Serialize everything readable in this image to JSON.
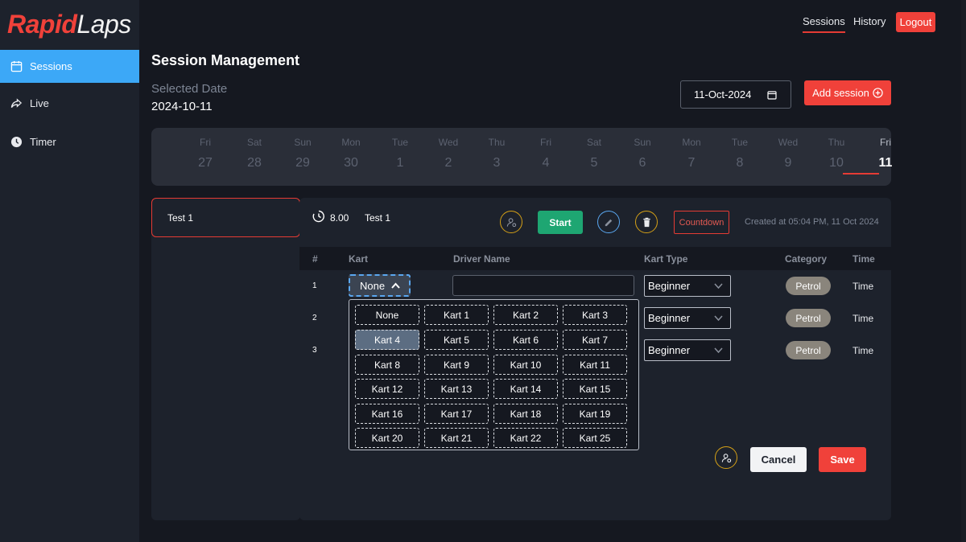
{
  "app": {
    "logo_part1": "Rapid",
    "logo_part2": "Laps"
  },
  "sidebar": {
    "items": [
      {
        "label": "Sessions",
        "icon": "calendar-icon",
        "active": true
      },
      {
        "label": "Live",
        "icon": "share-arrow-icon"
      },
      {
        "label": "Timer",
        "icon": "clock-icon"
      }
    ]
  },
  "topnav": {
    "sessions": "Sessions",
    "history": "History",
    "logout": "Logout"
  },
  "page": {
    "title": "Session Management",
    "selected_date_label": "Selected Date",
    "selected_date_value": "2024-10-11",
    "date_input_value": "11-Oct-2024",
    "add_session_label": "Add session"
  },
  "datestrip": {
    "days": [
      {
        "name": "Fri",
        "num": "27"
      },
      {
        "name": "Sat",
        "num": "28"
      },
      {
        "name": "Sun",
        "num": "29"
      },
      {
        "name": "Mon",
        "num": "30"
      },
      {
        "name": "Tue",
        "num": "1"
      },
      {
        "name": "Wed",
        "num": "2"
      },
      {
        "name": "Thu",
        "num": "3"
      },
      {
        "name": "Fri",
        "num": "4"
      },
      {
        "name": "Sat",
        "num": "5"
      },
      {
        "name": "Sun",
        "num": "6"
      },
      {
        "name": "Mon",
        "num": "7"
      },
      {
        "name": "Tue",
        "num": "8"
      },
      {
        "name": "Wed",
        "num": "9"
      },
      {
        "name": "Thu",
        "num": "10"
      },
      {
        "name": "Fri",
        "num": "11",
        "active": true
      }
    ]
  },
  "sessions": [
    {
      "name": "Test 1"
    }
  ],
  "detail": {
    "duration": "8.00",
    "name": "Test 1",
    "start_label": "Start",
    "countdown_label": "Countdown",
    "created": "Created at 05:04 PM, 11 Oct 2024"
  },
  "table": {
    "headers": {
      "num": "#",
      "kart": "Kart",
      "driver": "Driver Name",
      "kart_type": "Kart Type",
      "category": "Category",
      "time": "Time"
    },
    "rows": [
      {
        "num": "1",
        "kart": "None",
        "kart_type": "Beginner",
        "category": "Petrol",
        "time": "Time"
      },
      {
        "num": "2",
        "kart_type": "Beginner",
        "category": "Petrol",
        "time": "Time"
      },
      {
        "num": "3",
        "kart_type": "Beginner",
        "category": "Petrol",
        "time": "Time"
      }
    ]
  },
  "kart_options": [
    "None",
    "Kart 1",
    "Kart 2",
    "Kart 3",
    "Kart 4",
    "Kart 5",
    "Kart 6",
    "Kart 7",
    "Kart 8",
    "Kart 9",
    "Kart 10",
    "Kart 11",
    "Kart 12",
    "Kart 13",
    "Kart 14",
    "Kart 15",
    "Kart 16",
    "Kart 17",
    "Kart 18",
    "Kart 19",
    "Kart 20",
    "Kart 21",
    "Kart 22",
    "Kart 25"
  ],
  "kart_selected_highlight": "Kart 4",
  "footer": {
    "cancel": "Cancel",
    "save": "Save"
  },
  "colors": {
    "accent": "#f0413a",
    "active_blue": "#3ca8f7",
    "start_green": "#1ea672",
    "icon_gold": "#d4a017"
  }
}
